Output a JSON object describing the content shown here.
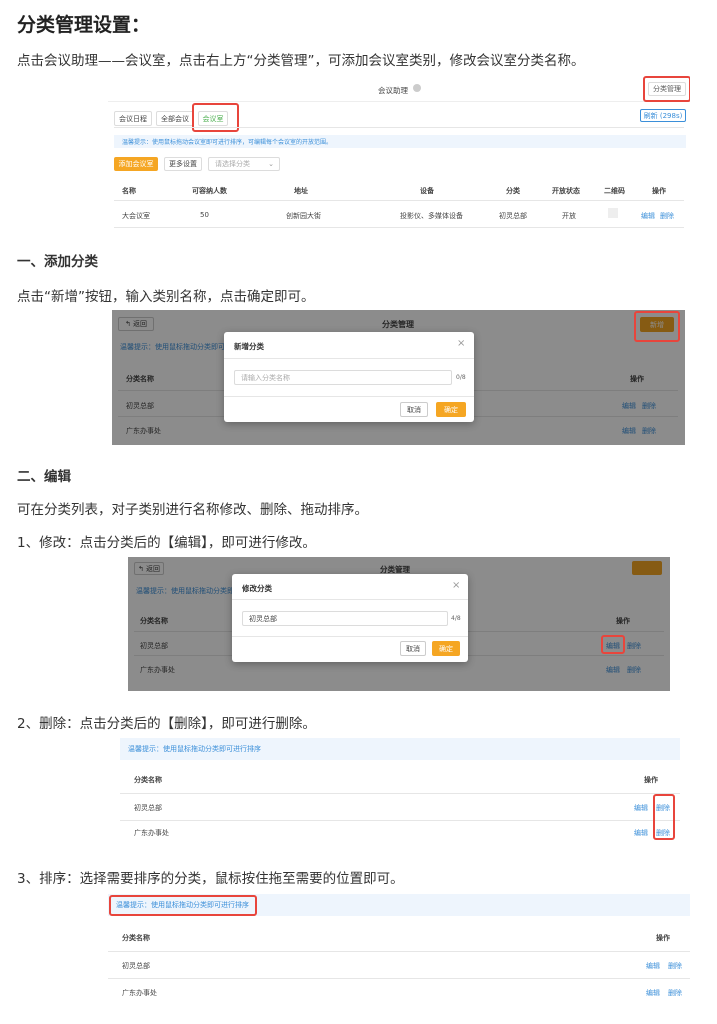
{
  "title": "分类管理设置：",
  "intro": "点击会议助理——会议室，点击右上方“分类管理”，可添加会议室类别，修改会议室分类名称。",
  "shot1": {
    "header_title": "会议助理",
    "manage_button": "分类管理",
    "tabs": [
      "会议日程",
      "全部会议",
      "会议室"
    ],
    "refresh_button": "刷新 (298s)",
    "tip": "温馨提示：使用鼠标拖动会议室即可进行排序，可编辑每个会议室的开放范围。",
    "add_button": "添加会议室",
    "more_button": "更多设置",
    "select_placeholder": "请选择分类",
    "columns": [
      "名称",
      "可容纳人数",
      "地址",
      "设备",
      "分类",
      "开放状态",
      "二维码",
      "操作"
    ],
    "row": [
      "大会议室",
      "50",
      "创新园大街",
      "投影仪、多媒体设备",
      "初灵总部",
      "开放"
    ],
    "edit": "编辑",
    "delete": "删除"
  },
  "section1_heading": "一、添加分类",
  "section1_text": "点击“新增”按钮，输入类别名称，点击确定即可。",
  "shot2": {
    "back_button": "返回",
    "title": "分类管理",
    "new_button": "新增",
    "tip": "温馨提示：使用鼠标拖动分类即可进行排序",
    "col_name": "分类名称",
    "col_action": "操作",
    "rows": [
      "初灵总部",
      "广东办事处"
    ],
    "edit": "编辑",
    "delete": "删除",
    "modal_title": "新增分类",
    "input_placeholder": "请输入分类名称",
    "counter": "0/8",
    "cancel": "取消",
    "confirm": "确定"
  },
  "section2_heading": "二、编辑",
  "section2_text": "可在分类列表，对子类别进行名称修改、删除、拖动排序。",
  "step1_text": "1、修改：点击分类后的【编辑】，即可进行修改。",
  "shot3": {
    "back_button": "返回",
    "title": "分类管理",
    "tip": "温馨提示：使用鼠标拖动分类即可进行排序",
    "col_name": "分类名称",
    "col_action": "操作",
    "rows": [
      "初灵总部",
      "广东办事处"
    ],
    "edit": "编辑",
    "delete": "删除",
    "modal_title": "修改分类",
    "input_value": "初灵总部",
    "counter": "4/8",
    "cancel": "取消",
    "confirm": "确定"
  },
  "step2_text": "2、删除：点击分类后的【删除】，即可进行删除。",
  "shot4": {
    "tip": "温馨提示：使用鼠标拖动分类即可进行排序",
    "col_name": "分类名称",
    "col_action": "操作",
    "rows": [
      "初灵总部",
      "广东办事处"
    ],
    "edit": "编辑",
    "delete": "删除"
  },
  "step3_text": "3、排序：选择需要排序的分类，鼠标按住拖至需要的位置即可。",
  "shot5": {
    "tip": "温馨提示：使用鼠标拖动分类即可进行排序",
    "col_name": "分类名称",
    "col_action": "操作",
    "rows": [
      "初灵总部",
      "广东办事处"
    ],
    "edit": "编辑",
    "delete": "删除"
  }
}
